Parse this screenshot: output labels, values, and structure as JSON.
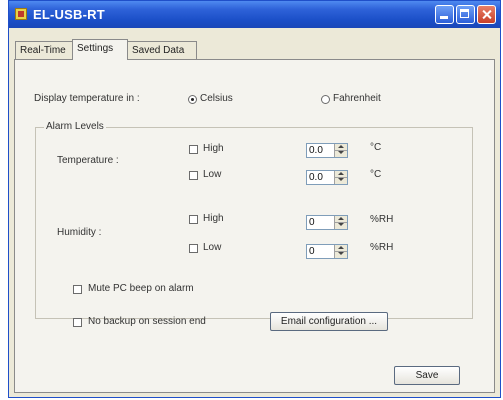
{
  "window": {
    "title": "EL-USB-RT"
  },
  "tabs": [
    {
      "label": "Real-Time"
    },
    {
      "label": "Settings"
    },
    {
      "label": "Saved Data"
    }
  ],
  "settings": {
    "display_temp_label": "Display temperature in :",
    "celsius_label": "Celsius",
    "fahrenheit_label": "Fahrenheit",
    "selected_unit": "Celsius",
    "alarm_group_title": "Alarm Levels",
    "temperature_label": "Temperature :",
    "humidity_label": "Humidity :",
    "temp_high": {
      "label": "High",
      "value": "0.0",
      "unit": "°C"
    },
    "temp_low": {
      "label": "Low",
      "value": "0.0",
      "unit": "°C"
    },
    "hum_high": {
      "label": "High",
      "value": "0",
      "unit": "%RH"
    },
    "hum_low": {
      "label": "Low",
      "value": "0",
      "unit": "%RH"
    },
    "mute_label": "Mute PC beep on alarm",
    "no_backup_label": "No backup on session end",
    "email_button": "Email configuration ...",
    "save_button": "Save"
  }
}
